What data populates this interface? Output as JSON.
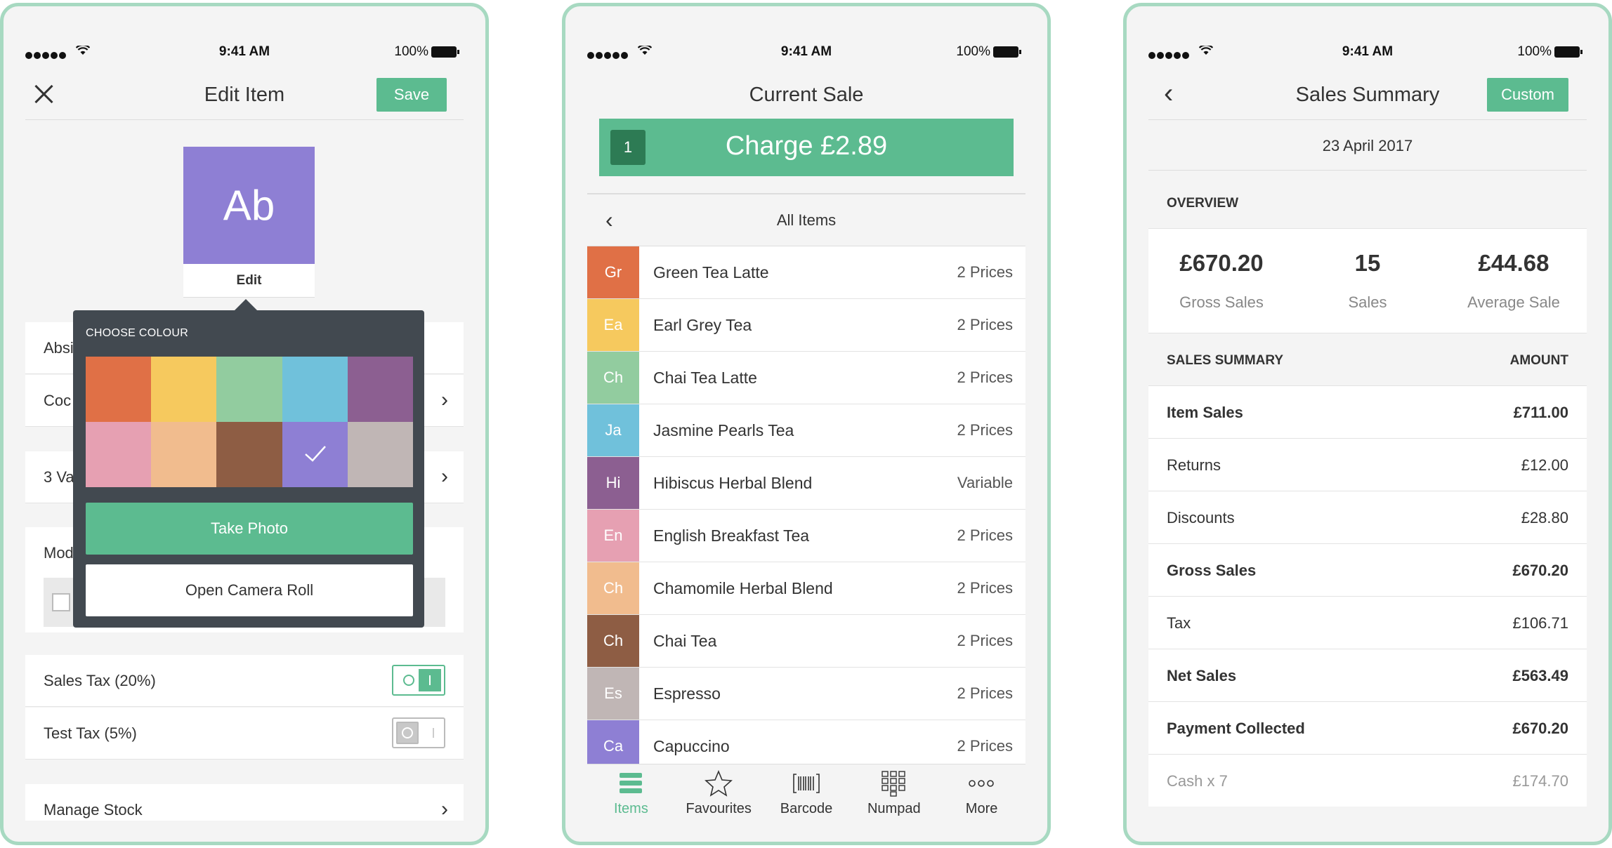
{
  "status": {
    "time": "9:41 AM",
    "battery": "100%"
  },
  "colors": {
    "accent": "#5cbb90",
    "popover": "#424950",
    "frame": "#a7d9c1"
  },
  "edit_item": {
    "title": "Edit Item",
    "save_label": "Save",
    "tile_text": "Ab",
    "tile_color": "#8e7fd4",
    "tile_edit_label": "Edit",
    "rows": [
      {
        "label": "Absinthe"
      },
      {
        "label": "Coc"
      },
      {
        "label": "3 Va"
      }
    ],
    "modifiers_label": "Modifiers",
    "taxes": [
      {
        "label": "Sales Tax (20%)",
        "enabled": true
      },
      {
        "label": "Test Tax (5%)",
        "enabled": false
      }
    ],
    "manage_stock": "Manage Stock",
    "popover": {
      "title": "CHOOSE COLOUR",
      "swatches": [
        "#e07046",
        "#f6c95e",
        "#92cc9f",
        "#70c1db",
        "#8c5f91",
        "#e6a0b2",
        "#f1bc8e",
        "#8e5d44",
        "#8e7fd4",
        "#c0b6b5"
      ],
      "selected_index": 8,
      "take_photo": "Take Photo",
      "camera_roll": "Open Camera Roll"
    }
  },
  "current_sale": {
    "title": "Current Sale",
    "charge_count": "1",
    "charge_label": "Charge £2.89",
    "category": "All Items",
    "items": [
      {
        "abbr": "Gr",
        "name": "Green Tea Latte",
        "price": "2 Prices",
        "color": "#e07046"
      },
      {
        "abbr": "Ea",
        "name": "Earl Grey Tea",
        "price": "2 Prices",
        "color": "#f6c95e"
      },
      {
        "abbr": "Ch",
        "name": "Chai Tea Latte",
        "price": "2 Prices",
        "color": "#92cc9f"
      },
      {
        "abbr": "Ja",
        "name": "Jasmine Pearls Tea",
        "price": "2 Prices",
        "color": "#70c1db"
      },
      {
        "abbr": "Hi",
        "name": "Hibiscus Herbal Blend",
        "price": "Variable",
        "color": "#8c5f91"
      },
      {
        "abbr": "En",
        "name": "English Breakfast Tea",
        "price": "2 Prices",
        "color": "#e6a0b2"
      },
      {
        "abbr": "Ch",
        "name": "Chamomile Herbal Blend",
        "price": "2 Prices",
        "color": "#f1bc8e"
      },
      {
        "abbr": "Ch",
        "name": "Chai Tea",
        "price": "2 Prices",
        "color": "#8e5d44"
      },
      {
        "abbr": "Es",
        "name": "Espresso",
        "price": "2 Prices",
        "color": "#c0b6b5"
      },
      {
        "abbr": "Ca",
        "name": "Capuccino",
        "price": "2 Prices",
        "color": "#8e7fd4"
      }
    ],
    "tabs": [
      {
        "label": "Items",
        "icon": "items-stack-icon",
        "active": true
      },
      {
        "label": "Favourites",
        "icon": "star-icon",
        "active": false
      },
      {
        "label": "Barcode",
        "icon": "barcode-icon",
        "active": false
      },
      {
        "label": "Numpad",
        "icon": "numpad-icon",
        "active": false
      },
      {
        "label": "More",
        "icon": "more-dots-icon",
        "active": false
      }
    ]
  },
  "sales_summary": {
    "title": "Sales Summary",
    "custom_label": "Custom",
    "date": "23 April 2017",
    "overview_heading": "OVERVIEW",
    "overview": [
      {
        "value": "£670.20",
        "label": "Gross Sales"
      },
      {
        "value": "15",
        "label": "Sales"
      },
      {
        "value": "£44.68",
        "label": "Average Sale"
      }
    ],
    "summary_heading": "SALES SUMMARY",
    "amount_heading": "AMOUNT",
    "rows": [
      {
        "label": "Item Sales",
        "amount": "£711.00",
        "style": "bold"
      },
      {
        "label": "Returns",
        "amount": "£12.00",
        "style": "normal"
      },
      {
        "label": "Discounts",
        "amount": "£28.80",
        "style": "normal"
      },
      {
        "label": "Gross Sales",
        "amount": "£670.20",
        "style": "bold"
      },
      {
        "label": "Tax",
        "amount": "£106.71",
        "style": "normal"
      },
      {
        "label": "Net Sales",
        "amount": "£563.49",
        "style": "bold"
      },
      {
        "label": "Payment Collected",
        "amount": "£670.20",
        "style": "bold"
      },
      {
        "label": "Cash x 7",
        "amount": "£174.70",
        "style": "muted"
      }
    ]
  }
}
